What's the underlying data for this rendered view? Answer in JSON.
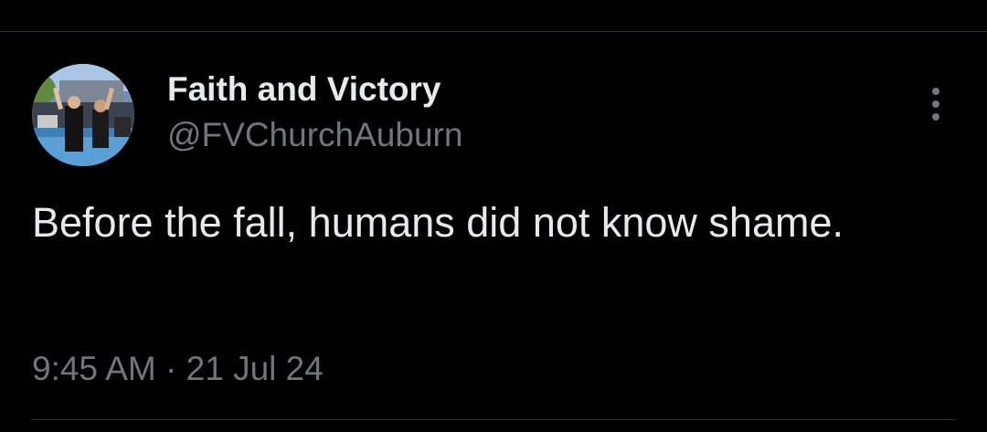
{
  "tweet": {
    "author": {
      "display_name": "Faith and Victory",
      "handle": "@FVChurchAuburn",
      "avatar_icon": "profile-photo"
    },
    "text": "Before the fall, humans did not know shame.",
    "time": "9:45 AM",
    "separator": "·",
    "date": "21 Jul 24",
    "more_icon": "more-vertical-icon"
  },
  "colors": {
    "background": "#000000",
    "primary_text": "#e7e9ea",
    "secondary_text": "#71767b",
    "divider": "#2f3336"
  }
}
